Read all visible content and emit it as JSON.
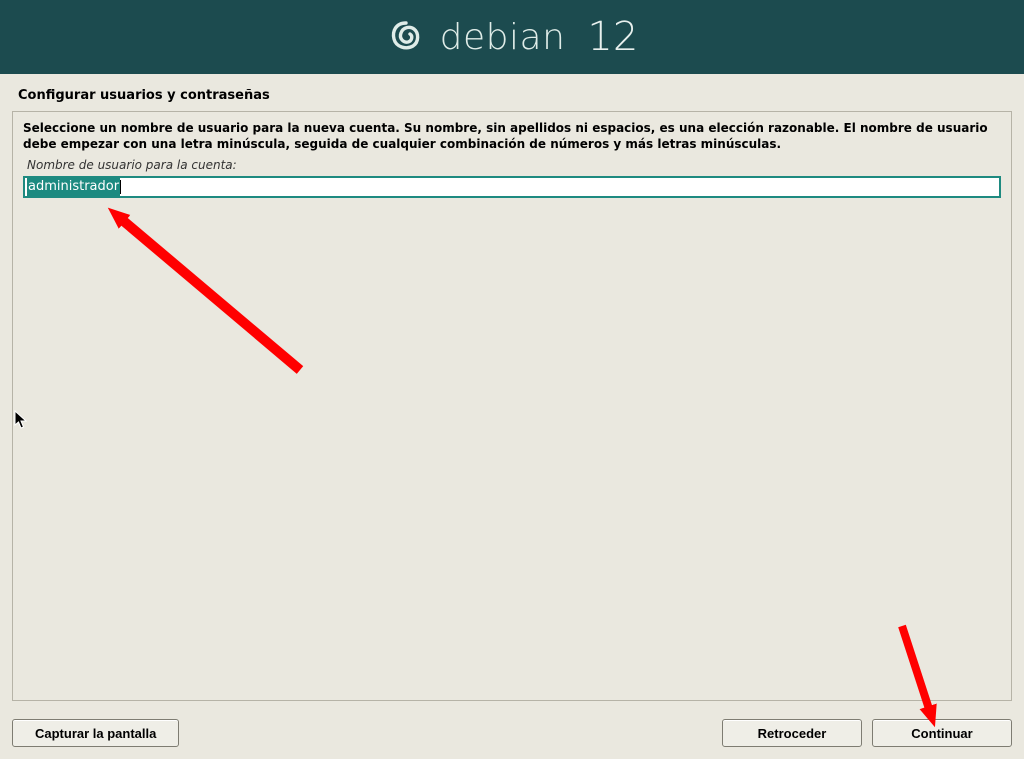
{
  "header": {
    "brand": "debian",
    "version": "12"
  },
  "section_title": "Configurar usuarios y contraseñas",
  "instructions": "Seleccione un nombre de usuario para la nueva cuenta. Su nombre, sin apellidos ni espacios, es una elección razonable. El nombre de usuario debe empezar con una letra minúscula, seguida de cualquier combinación de números y más letras minúsculas.",
  "field_label": "Nombre de usuario para la cuenta:",
  "username_value": "administrador",
  "buttons": {
    "screenshot": "Capturar la pantalla",
    "back": "Retroceder",
    "continue": "Continuar"
  }
}
